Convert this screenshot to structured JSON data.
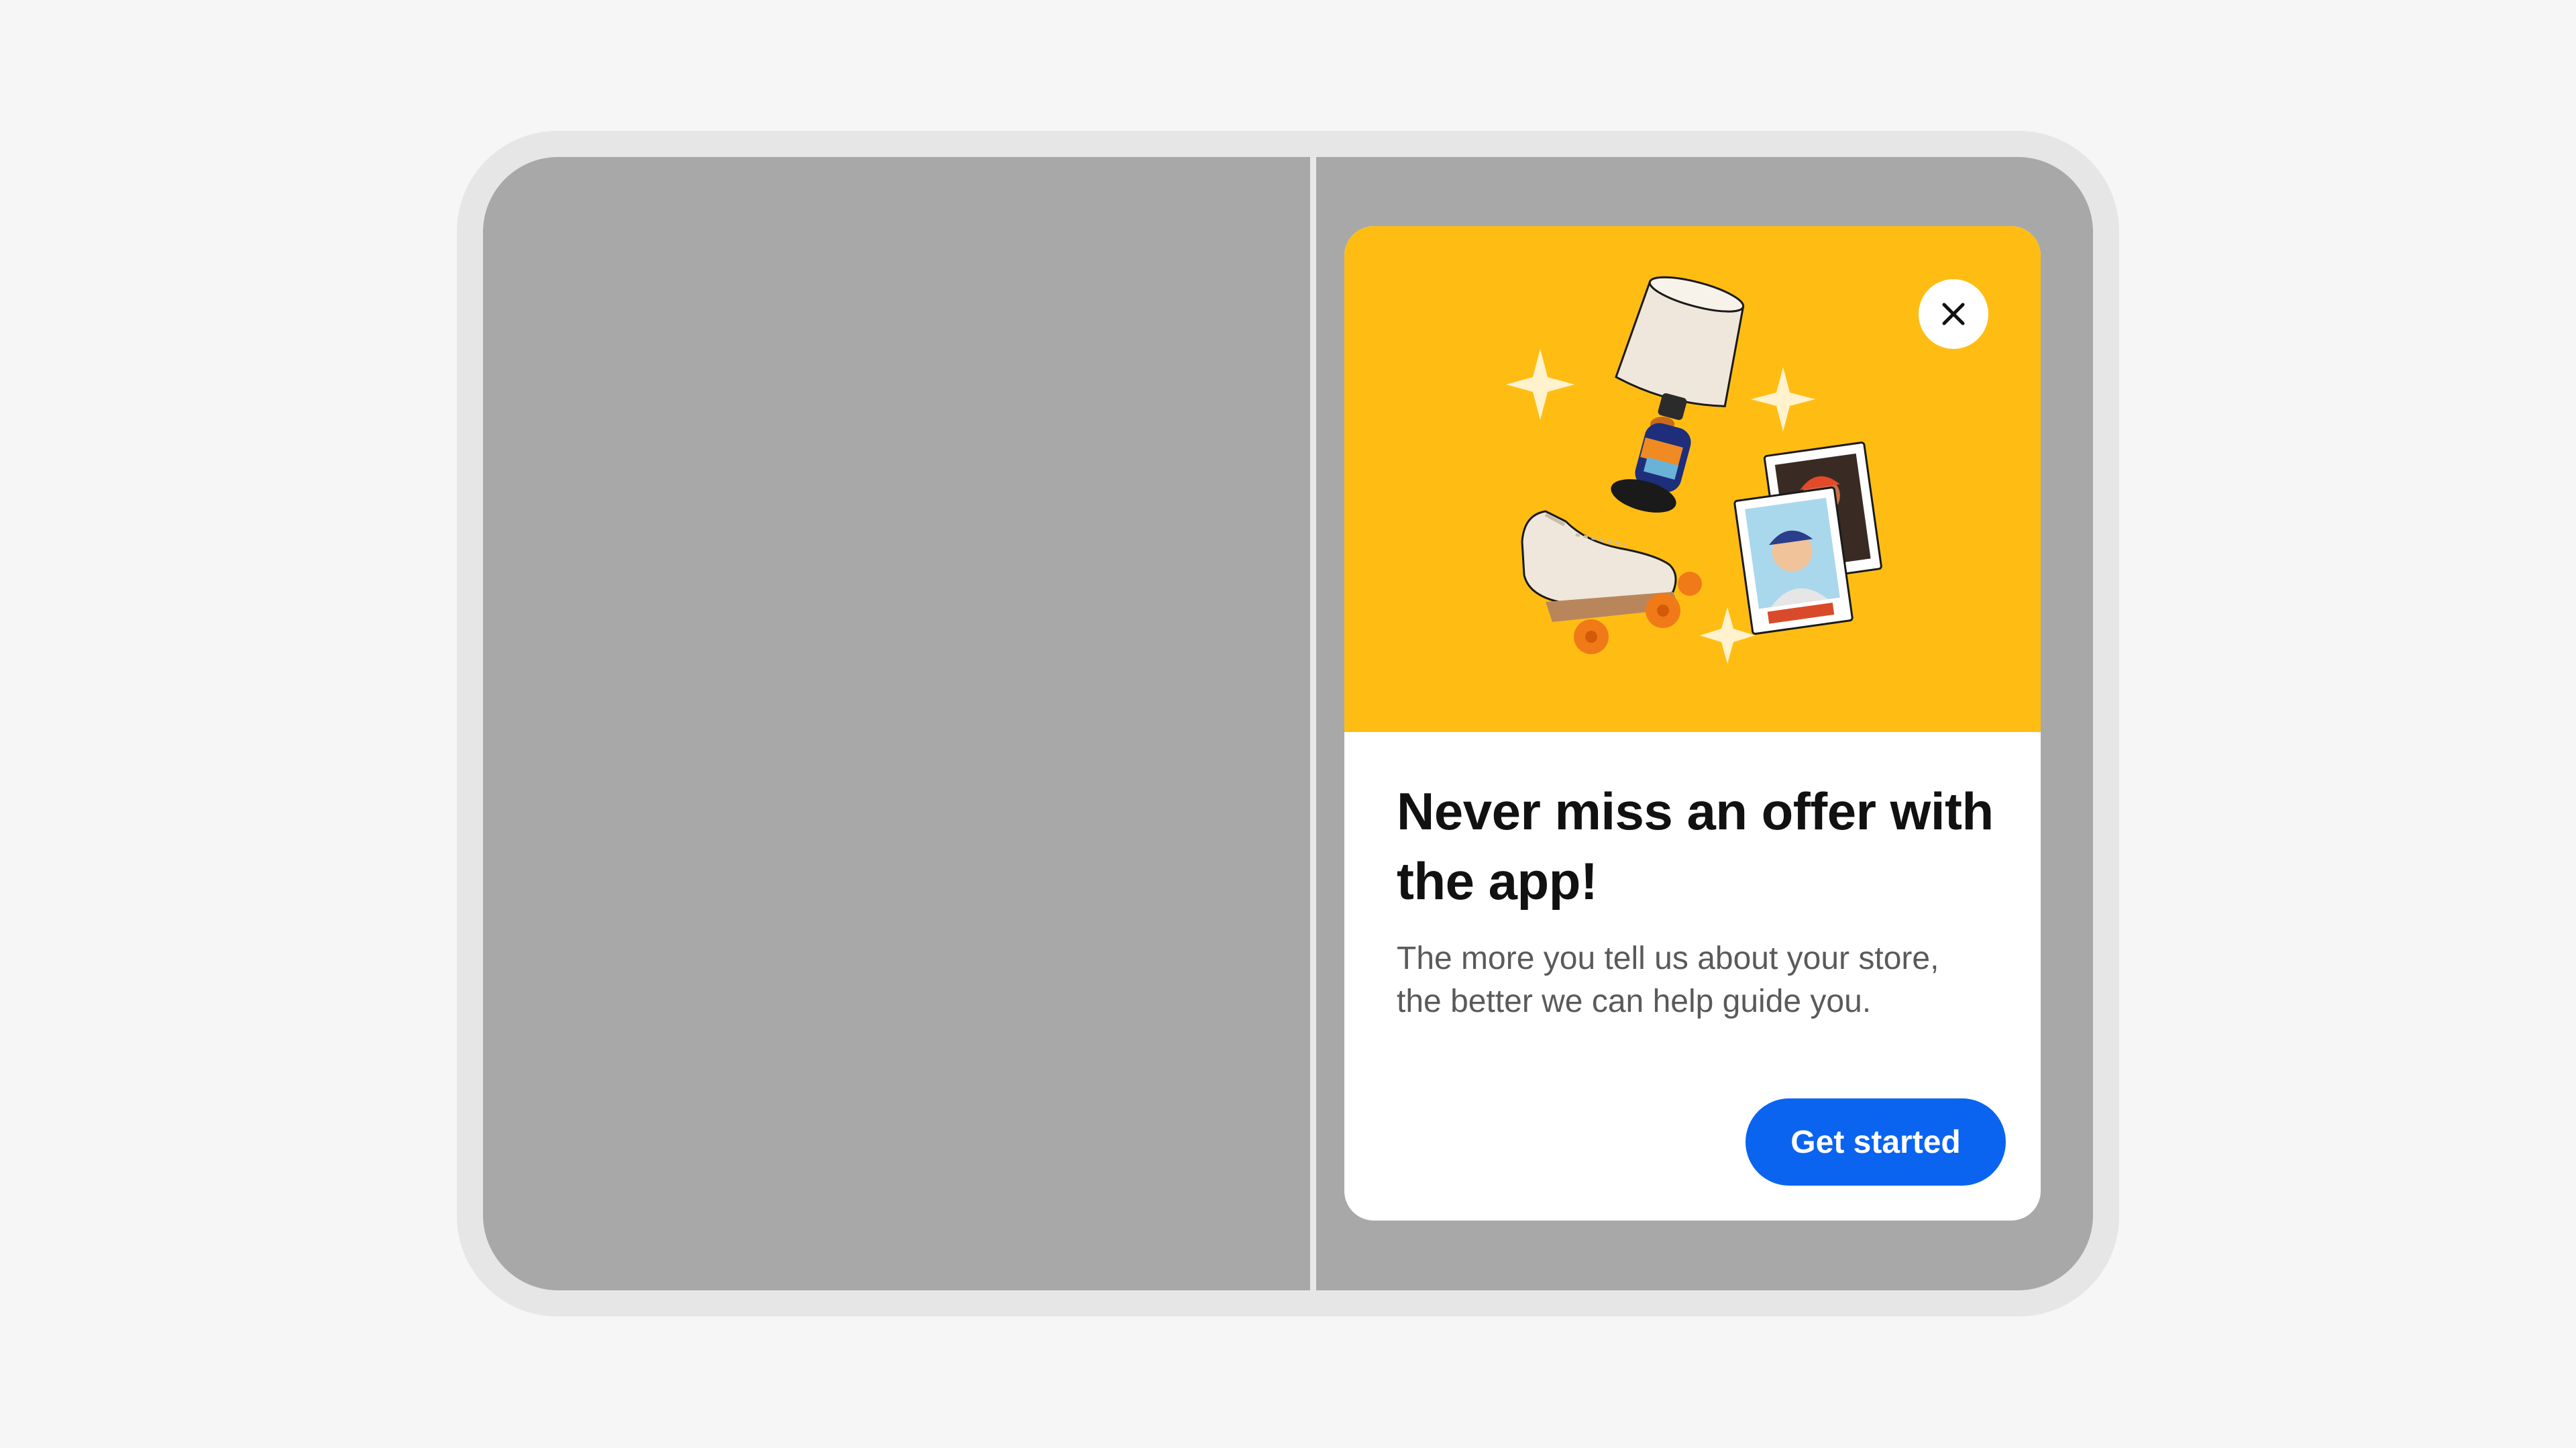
{
  "colors": {
    "page_bg": "#f6f6f6",
    "device_frame": "#e6e6e6",
    "screen_bg": "#a8a8a8",
    "hero_bg": "#ffbd14",
    "primary_button": "#0a64f0",
    "title_text": "#111111",
    "body_text": "#5a5a5a"
  },
  "dialog": {
    "close_icon": "close-icon",
    "title": "Never miss an offer with the app!",
    "body": "The more you tell us about your store, the better we can help guide you.",
    "cta_label": "Get started"
  },
  "illustration": {
    "items": [
      "lamp",
      "roller-skate",
      "trading-cards",
      "sparkles"
    ]
  }
}
